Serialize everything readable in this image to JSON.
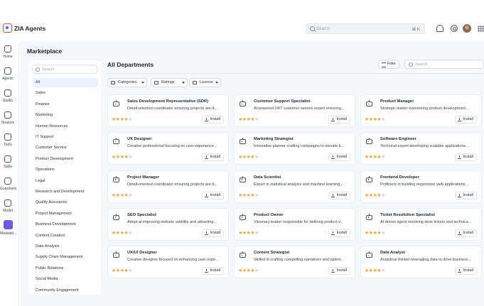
{
  "app": {
    "title": "ZIA Agents"
  },
  "topbar": {
    "search_placeholder": "Search",
    "shortcut": "⌘ K",
    "icons": [
      "bell-icon",
      "gear-icon",
      "avatar",
      "apps-grid-icon"
    ]
  },
  "rail": [
    {
      "label": "Home",
      "icon": "home-icon"
    },
    {
      "label": "Agents",
      "icon": "agents-icon"
    },
    {
      "label": "Studio",
      "icon": "studio-icon"
    },
    {
      "label": "Sources",
      "icon": "folder-icon"
    },
    {
      "label": "Tools",
      "icon": "tools-icon"
    },
    {
      "label": "Skills",
      "icon": "skills-icon"
    },
    {
      "label": "Guardrails",
      "icon": "shield-icon"
    },
    {
      "label": "Model",
      "icon": "model-icon"
    },
    {
      "label": "Marketpl...",
      "icon": "marketplace-icon",
      "active": true
    }
  ],
  "page_title": "Marketplace",
  "departments": {
    "search_placeholder": "Search",
    "items": [
      "All",
      "Sales",
      "Finance",
      "Marketing",
      "Human Resources",
      "IT Support",
      "Customer Service",
      "Product Development",
      "Operations",
      "Legal",
      "Research and Development",
      "Quality Assurance",
      "Project Management",
      "Business Development",
      "Content Creation",
      "Data Analysis",
      "Supply Chain Management",
      "Public Relations",
      "Social Media",
      "Community Engagement"
    ],
    "active": "All"
  },
  "main": {
    "heading": "All Departments",
    "filter_label": "Filter",
    "search_placeholder": "Search",
    "dropdowns": [
      "Categories",
      "Ratings",
      "License"
    ]
  },
  "install_label": "Install",
  "cards": [
    {
      "title": "Sales Development Representative (SDR)",
      "desc": "Detail-oriented coordinator ensuring projects are d...",
      "rating": 3.5
    },
    {
      "title": "Customer Support Specialist",
      "desc": "AI-powered 24/7 customer service expert ensuring...",
      "rating": 3.5
    },
    {
      "title": "Product Manager",
      "desc": "Strategic leader overseeing product development...",
      "rating": 3.5
    },
    {
      "title": "UX Designer",
      "desc": "Creative professional focusing on user experience...",
      "rating": 3.5
    },
    {
      "title": "Marketing Strategist",
      "desc": "Innovative planner crafting campaigns to elevate b...",
      "rating": 3.5
    },
    {
      "title": "Software Engineer",
      "desc": "Technical expert developing scalable applications...",
      "rating": 3.5
    },
    {
      "title": "Project Manager",
      "desc": "Detail-oriented coordinator ensuring projects are d...",
      "rating": 3.5
    },
    {
      "title": "Data Scientist",
      "desc": "Expert in statistical analysis and machine learning,...",
      "rating": 3.5
    },
    {
      "title": "Frontend Developer",
      "desc": "Proficient in building responsive web applications...",
      "rating": 3.5
    },
    {
      "title": "SEO Specialist",
      "desc": "Adept at improving website visibility and attracting...",
      "rating": 3.5
    },
    {
      "title": "Product Owner",
      "desc": "Visionary leader responsible for defining product v...",
      "rating": 3.5
    },
    {
      "title": "Ticket Resolution Specialist",
      "desc": "AI-driven agent resolving desk tickets and technica...",
      "rating": 3.5
    },
    {
      "title": "UX/UI Designer",
      "desc": "Creative designer focused on enhancing user expe...",
      "rating": 3.5
    },
    {
      "title": "Content Strategist",
      "desc": "Skilled in crafting compelling narratives and optimi...",
      "rating": 3.5
    },
    {
      "title": "Data Analyst",
      "desc": "Analytical thinker leveraging data to drive business...",
      "rating": 3.5
    }
  ]
}
